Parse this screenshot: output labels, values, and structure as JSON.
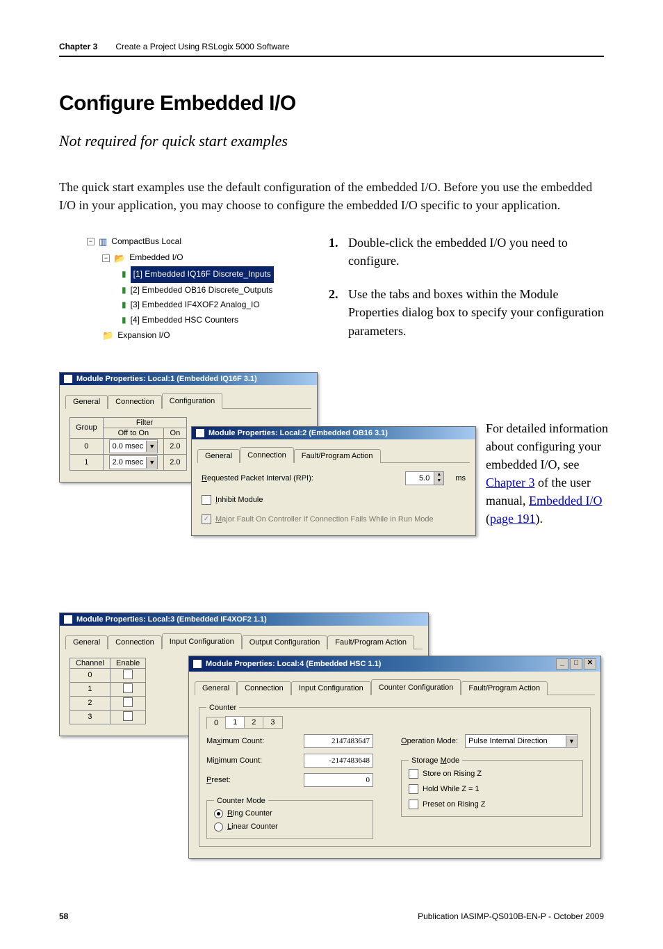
{
  "header": {
    "chapter": "Chapter 3",
    "title": "Create a Project Using RSLogix 5000 Software"
  },
  "section_title": "Configure Embedded I/O",
  "subtitle": "Not required for quick start examples",
  "body_para": "The quick start examples use the default configuration of the embedded I/O. Before you use the embedded I/O in your application, you may choose to configure the embedded I/O specific to your application.",
  "steps": {
    "s1_num": "1.",
    "s1": "Double-click the embedded I/O you need to configure.",
    "s2_num": "2.",
    "s2": "Use the tabs and boxes within the Module Properties dialog box to specify your configuration parameters."
  },
  "tree": {
    "root": "CompactBus Local",
    "folder": "Embedded I/O",
    "items": [
      "[1] Embedded IQ16F Discrete_Inputs",
      "[2] Embedded OB16 Discrete_Outputs",
      "[3] Embedded IF4XOF2 Analog_IO",
      "[4] Embedded HSC Counters"
    ],
    "expansion": "Expansion I/O"
  },
  "d1": {
    "title": "Module Properties: Local:1 (Embedded IQ16F 3.1)",
    "tabs": [
      "General",
      "Connection",
      "Configuration"
    ],
    "group_label": "Group",
    "filter_label": "Filter",
    "cols": [
      "Off to On",
      "On"
    ],
    "rows": [
      "0",
      "1"
    ],
    "vals": [
      [
        "0.0 msec",
        "2.0 "
      ],
      [
        "2.0 msec",
        "2.0 "
      ]
    ]
  },
  "d2": {
    "title": "Module Properties: Local:2 (Embedded OB16 3.1)",
    "tabs": [
      "General",
      "Connection",
      "Fault/Program Action"
    ],
    "rpi_label": "Requested Packet Interval (RPI):",
    "rpi_value": "5.0",
    "rpi_unit": "ms",
    "inhibit": "Inhibit Module",
    "major_fault": "Major Fault On Controller If Connection Fails While in Run Mode"
  },
  "side_note": {
    "line1": "For detailed information about configuring your embedded I/O, see ",
    "link1": "Chapter 3",
    "line2": " of the user manual, ",
    "link2": "Embedded I/O",
    "paren_open": " (",
    "link3": "page 191",
    "paren_close": ")."
  },
  "d3": {
    "title": "Module Properties: Local:3 (Embedded IF4XOF2 1.1)",
    "tabs": [
      "General",
      "Connection",
      "Input Configuration",
      "Output Configuration",
      "Fault/Program Action"
    ],
    "ch_label": "Channel",
    "en_label": "Enable",
    "rows": [
      "0",
      "1",
      "2",
      "3"
    ]
  },
  "d4": {
    "title": "Module Properties: Local:4 (Embedded HSC 1.1)",
    "tabs": [
      "General",
      "Connection",
      "Input Configuration",
      "Counter Configuration",
      "Fault/Program Action"
    ],
    "counter_legend": "Counter",
    "sub_tabs": [
      "0",
      "1",
      "2",
      "3"
    ],
    "max_label": "Maximum Count:",
    "max_val": "2147483647",
    "min_label": "Minimum Count:",
    "min_val": "-2147483648",
    "preset_label": "Preset:",
    "preset_val": "0",
    "op_label": "Operation Mode:",
    "op_val": "Pulse Internal Direction",
    "counter_mode_legend": "Counter Mode",
    "ring": "Ring Counter",
    "linear": "Linear Counter",
    "storage_legend": "Storage Mode",
    "store_rising": "Store on Rising Z",
    "hold": "Hold While Z = 1",
    "preset_rising": "Preset on Rising Z"
  },
  "footer": {
    "page": "58",
    "pub": "Publication IASIMP-QS010B-EN-P - October 2009"
  }
}
